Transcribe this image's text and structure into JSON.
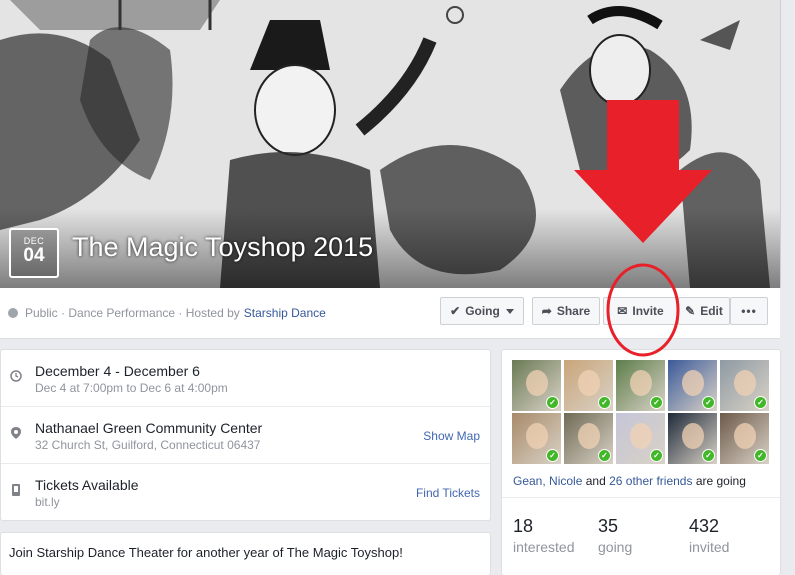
{
  "event": {
    "date_month": "DEC",
    "date_day": "04",
    "title": "The Magic Toyshop 2015",
    "privacy": "Public",
    "category": "Dance Performance",
    "hosted_by_prefix": "Hosted by",
    "host": "Starship Dance"
  },
  "actions": {
    "going": "Going",
    "share": "Share",
    "invite": "Invite",
    "edit": "Edit",
    "more": "•••"
  },
  "details": {
    "when_title": "December 4 - December 6",
    "when_sub": "Dec 4 at 7:00pm to Dec 6 at 4:00pm",
    "where_title": "Nathanael Green Community Center",
    "where_sub": "32 Church St, Guilford, Connecticut 06437",
    "show_map": "Show Map",
    "tickets_title": "Tickets Available",
    "tickets_sub": "bit.ly",
    "find_tickets": "Find Tickets"
  },
  "description": "Join Starship Dance Theater for another year of The Magic Toyshop!",
  "friends": {
    "names": "Gean, Nicole",
    "and": "and",
    "others": "26 other friends",
    "going_suffix": "are going",
    "thumb_colors": [
      "#6b7a55",
      "#c9a57a",
      "#5d7d4a",
      "#3b5a9a",
      "#8e9aa3",
      "#a88a6a",
      "#6f6a55",
      "#c5c5d8",
      "#1f2a3a",
      "#6d5a4a"
    ]
  },
  "stats": [
    {
      "num": "18",
      "label": "interested"
    },
    {
      "num": "35",
      "label": "going"
    },
    {
      "num": "432",
      "label": "invited"
    }
  ],
  "icons": [
    "globe-icon",
    "check-icon",
    "share-arrow-icon",
    "envelope-icon",
    "pencil-icon",
    "clock-icon",
    "map-pin-icon",
    "ticket-icon"
  ],
  "colors": {
    "link": "#365899",
    "annotation_red": "#e8202a",
    "going_green": "#42b72a"
  }
}
